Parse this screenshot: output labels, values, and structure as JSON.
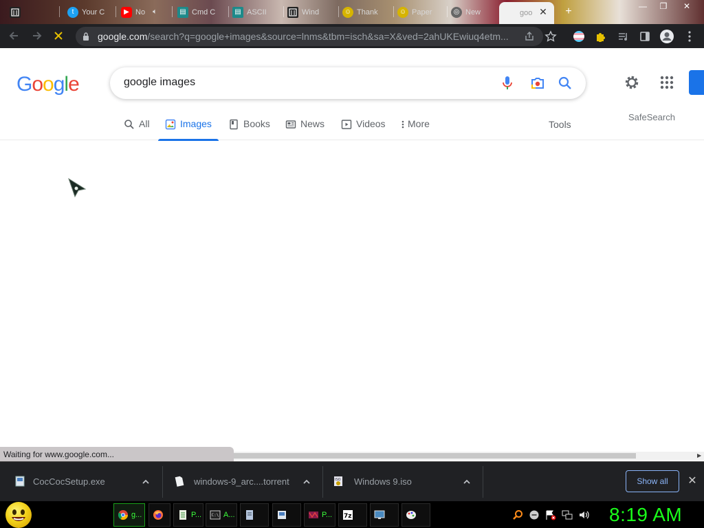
{
  "browser": {
    "tabs": [
      {
        "label": "",
        "icon": "library-icon"
      },
      {
        "label": "Your C",
        "icon": "twitter-icon"
      },
      {
        "label": "No",
        "icon": "youtube-icon"
      },
      {
        "label": "Cmd C",
        "icon": "terminal-icon"
      },
      {
        "label": "ASCII",
        "icon": "terminal-icon"
      },
      {
        "label": "Wind",
        "icon": "library-icon"
      },
      {
        "label": "Thank",
        "icon": "smiley-icon"
      },
      {
        "label": "Paper",
        "icon": "smiley-icon"
      },
      {
        "label": "New",
        "icon": "globe-icon"
      }
    ],
    "active_tab": {
      "label": "goo",
      "close": "✕"
    },
    "new_tab": "+",
    "window_controls": {
      "minimize": "—",
      "maximize": "❐",
      "close": "✕"
    },
    "url_host": "google.com",
    "url_rest": "/search?q=google+images&source=lnms&tbm=isch&sa=X&ved=2ahUKEwiuq4etm..."
  },
  "google": {
    "logo_letters": [
      {
        "ch": "G",
        "color": "#4285F4"
      },
      {
        "ch": "o",
        "color": "#EA4335"
      },
      {
        "ch": "o",
        "color": "#FBBC05"
      },
      {
        "ch": "g",
        "color": "#4285F4"
      },
      {
        "ch": "l",
        "color": "#34A853"
      },
      {
        "ch": "e",
        "color": "#EA4335"
      }
    ],
    "query": "google images",
    "nav_tabs": {
      "all": "All",
      "images": "Images",
      "books": "Books",
      "news": "News",
      "videos": "Videos",
      "more": "More"
    },
    "tools": "Tools",
    "safesearch": "SafeSearch"
  },
  "status": {
    "text": "Waiting for www.google.com...",
    "scroll_thumb_fraction": 0.87
  },
  "downloads": {
    "items": [
      {
        "name": "CocCocSetup.exe"
      },
      {
        "name": "windows-9_arc....torrent"
      },
      {
        "name": "Windows 9.iso"
      }
    ],
    "show_all": "Show all",
    "close": "✕"
  },
  "taskbar": {
    "tasks": [
      {
        "label": "g...",
        "icon": "chrome-icon"
      },
      {
        "label": "",
        "icon": "firefox-icon"
      },
      {
        "label": "P...",
        "icon": "notepad-icon"
      },
      {
        "label": "A...",
        "icon": "cmd-icon"
      },
      {
        "label": "",
        "icon": "document-icon"
      },
      {
        "label": "",
        "icon": "installer-icon"
      },
      {
        "label": "P...",
        "icon": "winrar-icon"
      },
      {
        "label": "",
        "icon": "7zip-icon"
      },
      {
        "label": "",
        "icon": "display-icon"
      },
      {
        "label": "",
        "icon": "paint-icon"
      }
    ],
    "tray": [
      "search-icon",
      "minus-circle-icon",
      "flag-icon",
      "network-icon",
      "volume-icon"
    ],
    "clock": "8:19 AM"
  }
}
